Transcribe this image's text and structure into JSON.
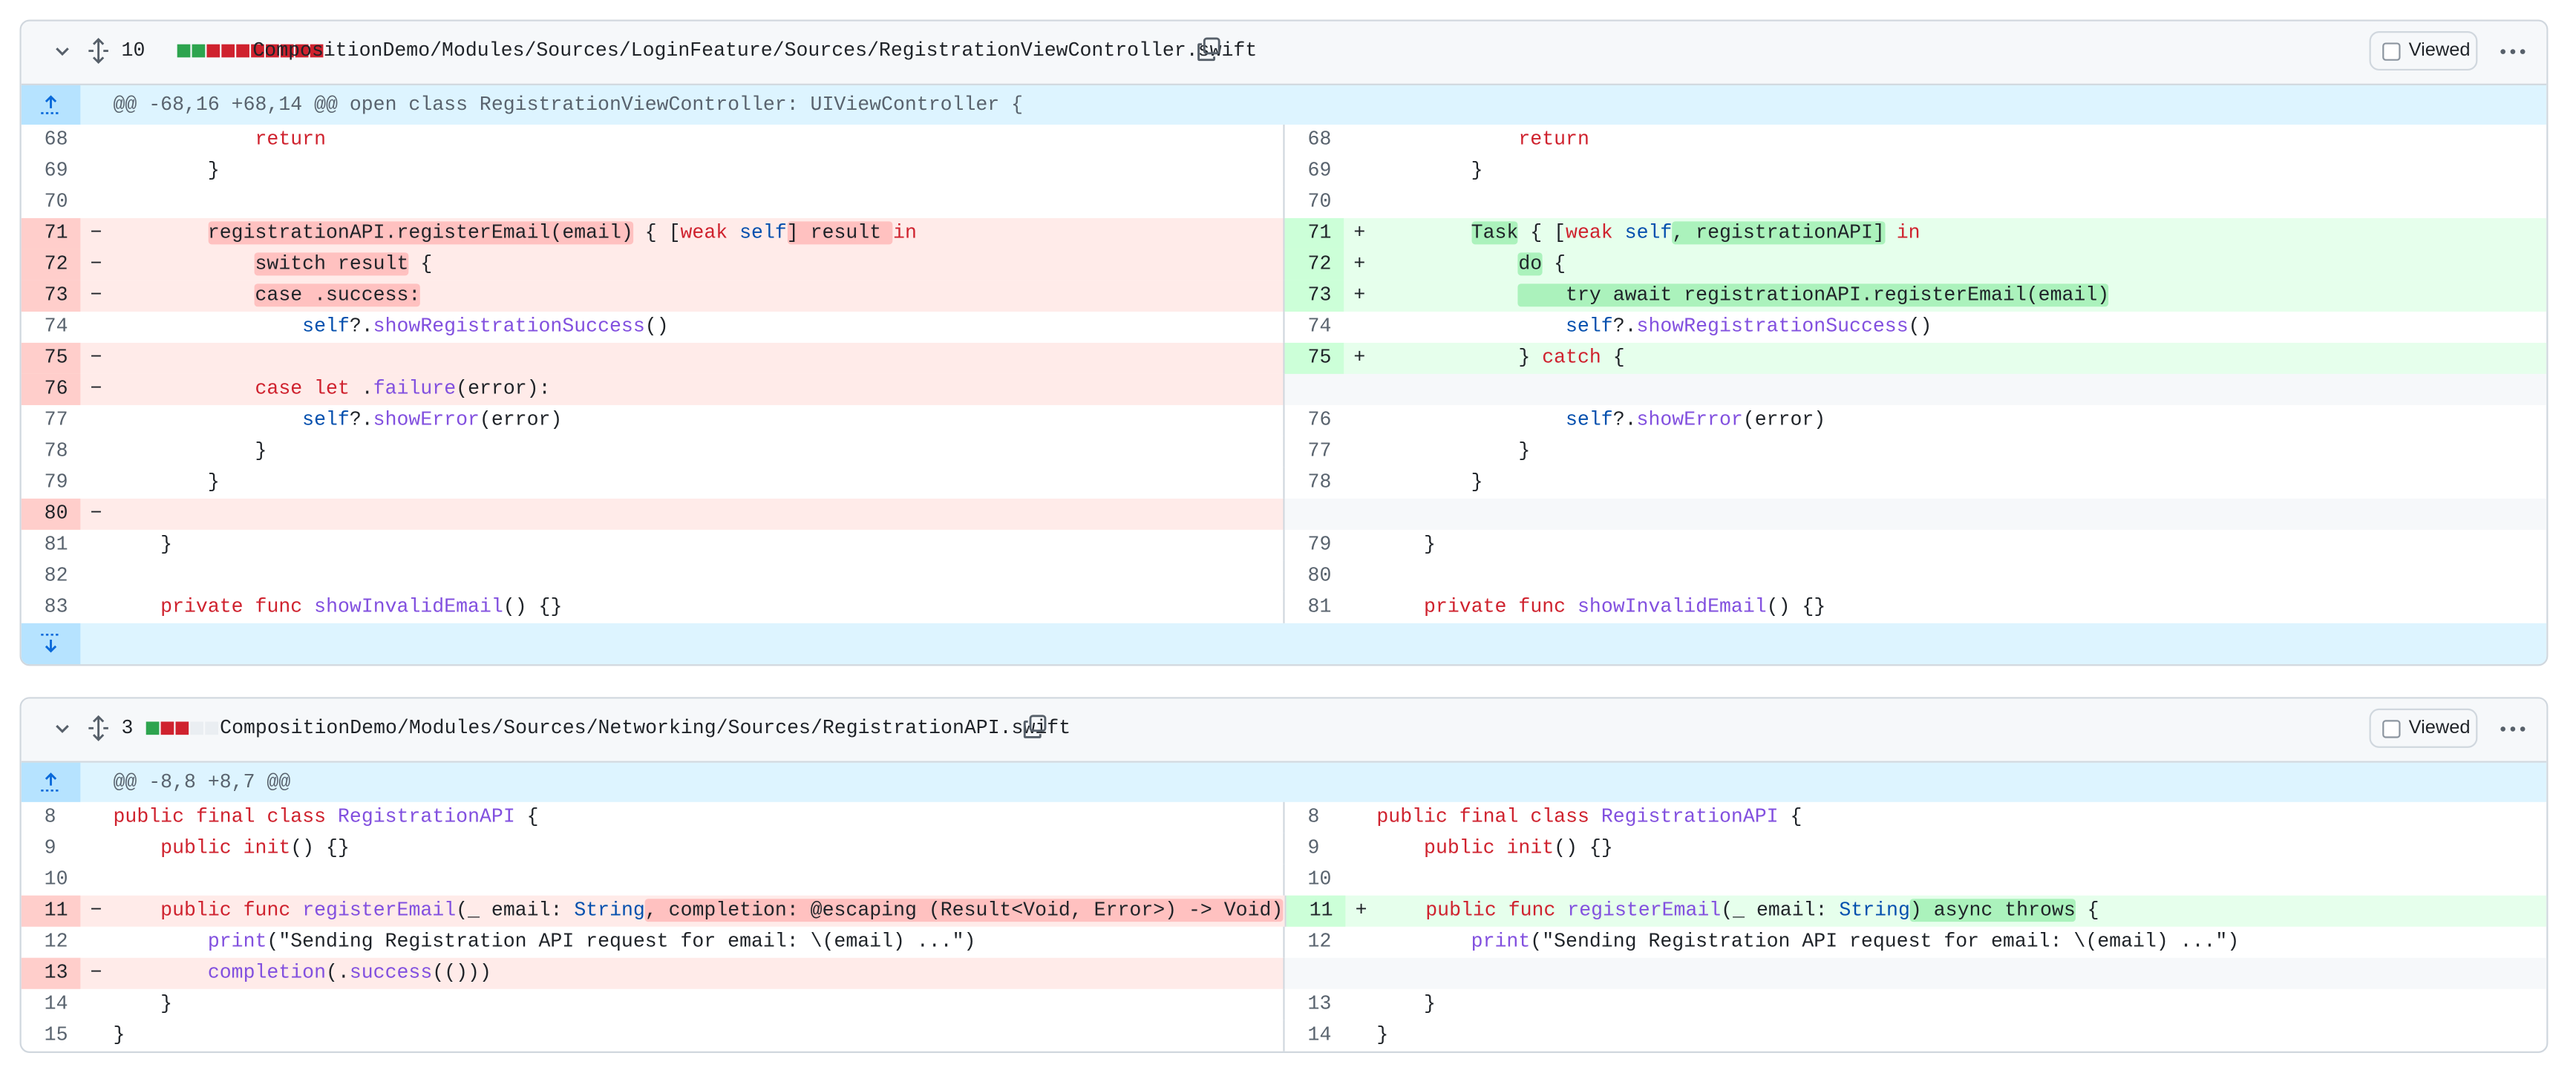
{
  "files": [
    {
      "change_count": "10",
      "blocks": [
        "add",
        "add",
        "del",
        "del",
        "del",
        "del",
        "del",
        "del",
        "del",
        "del"
      ],
      "path": "CompositionDemo/Modules/Sources/LoginFeature/Sources/RegistrationViewController.swift",
      "viewed_label": "Viewed",
      "hunk": "@@ -68,16 +68,14 @@ open class RegistrationViewController: UIViewController {",
      "rows": [
        {
          "l": {
            "n": "68",
            "t": "ctx",
            "c": [
              [
                "            ",
                ""
              ],
              [
                "return",
                "kw"
              ]
            ]
          },
          "r": {
            "n": "68",
            "t": "ctx",
            "c": [
              [
                "            ",
                ""
              ],
              [
                "return",
                "kw"
              ]
            ]
          }
        },
        {
          "l": {
            "n": "69",
            "t": "ctx",
            "c": [
              [
                "        }",
                ""
              ]
            ]
          },
          "r": {
            "n": "69",
            "t": "ctx",
            "c": [
              [
                "        }",
                ""
              ]
            ]
          }
        },
        {
          "l": {
            "n": "70",
            "t": "ctx",
            "c": []
          },
          "r": {
            "n": "70",
            "t": "ctx",
            "c": []
          }
        },
        {
          "l": {
            "n": "71",
            "t": "del",
            "c": [
              [
                "        ",
                ""
              ],
              [
                "registrationAPI.registerEmail(email)",
                "hd"
              ],
              [
                " { [",
                ""
              ],
              [
                "weak",
                "kw"
              ],
              [
                " ",
                ""
              ],
              [
                "self",
                "ty"
              ],
              [
                "] result ",
                "hd"
              ],
              [
                "in",
                "kw"
              ]
            ]
          },
          "r": {
            "n": "71",
            "t": "add",
            "c": [
              [
                "        ",
                ""
              ],
              [
                "Task",
                "ha"
              ],
              [
                " { [",
                ""
              ],
              [
                "weak",
                "kw"
              ],
              [
                " ",
                ""
              ],
              [
                "self",
                "ty"
              ],
              [
                ", registrationAPI]",
                "ha"
              ],
              [
                " ",
                ""
              ],
              [
                "in",
                "kw"
              ]
            ]
          }
        },
        {
          "l": {
            "n": "72",
            "t": "del",
            "c": [
              [
                "            ",
                ""
              ],
              [
                "switch result",
                "hd"
              ],
              [
                " {",
                ""
              ]
            ]
          },
          "r": {
            "n": "72",
            "t": "add",
            "c": [
              [
                "            ",
                ""
              ],
              [
                "do",
                "ha"
              ],
              [
                " {",
                ""
              ]
            ]
          }
        },
        {
          "l": {
            "n": "73",
            "t": "del",
            "c": [
              [
                "            ",
                ""
              ],
              [
                "case .success:",
                "hd"
              ]
            ]
          },
          "r": {
            "n": "73",
            "t": "add",
            "c": [
              [
                "            ",
                ""
              ],
              [
                "    try await registrationAPI.registerEmail(email)",
                "ha"
              ]
            ]
          }
        },
        {
          "l": {
            "n": "74",
            "t": "ctx",
            "c": [
              [
                "                ",
                ""
              ],
              [
                "self",
                "ty"
              ],
              [
                "?.",
                ""
              ],
              [
                "showRegistrationSuccess",
                "fn"
              ],
              [
                "()",
                ""
              ]
            ]
          },
          "r": {
            "n": "74",
            "t": "ctx",
            "c": [
              [
                "                ",
                ""
              ],
              [
                "self",
                "ty"
              ],
              [
                "?.",
                ""
              ],
              [
                "showRegistrationSuccess",
                "fn"
              ],
              [
                "()",
                ""
              ]
            ]
          }
        },
        {
          "l": {
            "n": "75",
            "t": "del",
            "c": []
          },
          "r": {
            "n": "75",
            "t": "add",
            "c": [
              [
                "            } ",
                ""
              ],
              [
                "catch",
                "kw"
              ],
              [
                " {",
                ""
              ]
            ]
          }
        },
        {
          "l": {
            "n": "76",
            "t": "del",
            "c": [
              [
                "            ",
                ""
              ],
              [
                "case",
                "kw"
              ],
              [
                " ",
                ""
              ],
              [
                "let",
                "kw"
              ],
              [
                " .",
                ""
              ],
              [
                "failure",
                "fn"
              ],
              [
                "(error):",
                ""
              ]
            ]
          },
          "r": {
            "n": "",
            "t": "empty",
            "c": []
          }
        },
        {
          "l": {
            "n": "77",
            "t": "ctx",
            "c": [
              [
                "                ",
                ""
              ],
              [
                "self",
                "ty"
              ],
              [
                "?.",
                ""
              ],
              [
                "showError",
                "fn"
              ],
              [
                "(error)",
                ""
              ]
            ]
          },
          "r": {
            "n": "76",
            "t": "ctx",
            "c": [
              [
                "                ",
                ""
              ],
              [
                "self",
                "ty"
              ],
              [
                "?.",
                ""
              ],
              [
                "showError",
                "fn"
              ],
              [
                "(error)",
                ""
              ]
            ]
          }
        },
        {
          "l": {
            "n": "78",
            "t": "ctx",
            "c": [
              [
                "            }",
                ""
              ]
            ]
          },
          "r": {
            "n": "77",
            "t": "ctx",
            "c": [
              [
                "            }",
                ""
              ]
            ]
          }
        },
        {
          "l": {
            "n": "79",
            "t": "ctx",
            "c": [
              [
                "        }",
                ""
              ]
            ]
          },
          "r": {
            "n": "78",
            "t": "ctx",
            "c": [
              [
                "        }",
                ""
              ]
            ]
          }
        },
        {
          "l": {
            "n": "80",
            "t": "del",
            "c": []
          },
          "r": {
            "n": "",
            "t": "empty",
            "c": []
          }
        },
        {
          "l": {
            "n": "81",
            "t": "ctx",
            "c": [
              [
                "    }",
                ""
              ]
            ]
          },
          "r": {
            "n": "79",
            "t": "ctx",
            "c": [
              [
                "    }",
                ""
              ]
            ]
          }
        },
        {
          "l": {
            "n": "82",
            "t": "ctx",
            "c": []
          },
          "r": {
            "n": "80",
            "t": "ctx",
            "c": []
          }
        },
        {
          "l": {
            "n": "83",
            "t": "ctx",
            "c": [
              [
                "    ",
                ""
              ],
              [
                "private",
                "kw"
              ],
              [
                " ",
                ""
              ],
              [
                "func",
                "kw"
              ],
              [
                " ",
                ""
              ],
              [
                "showInvalidEmail",
                "fn"
              ],
              [
                "() {}",
                ""
              ]
            ]
          },
          "r": {
            "n": "81",
            "t": "ctx",
            "c": [
              [
                "    ",
                ""
              ],
              [
                "private",
                "kw"
              ],
              [
                " ",
                ""
              ],
              [
                "func",
                "kw"
              ],
              [
                " ",
                ""
              ],
              [
                "showInvalidEmail",
                "fn"
              ],
              [
                "() {}",
                ""
              ]
            ]
          }
        }
      ]
    },
    {
      "change_count": "3",
      "blocks": [
        "add",
        "del",
        "del",
        "neutral",
        "neutral"
      ],
      "path": "CompositionDemo/Modules/Sources/Networking/Sources/RegistrationAPI.swift",
      "viewed_label": "Viewed",
      "hunk": "@@ -8,8 +8,7 @@",
      "rows": [
        {
          "l": {
            "n": "8",
            "t": "ctx",
            "c": [
              [
                "public",
                "kw"
              ],
              [
                " ",
                ""
              ],
              [
                "final",
                "kw"
              ],
              [
                " ",
                ""
              ],
              [
                "class",
                "kw"
              ],
              [
                " ",
                ""
              ],
              [
                "RegistrationAPI",
                "fn"
              ],
              [
                " {",
                ""
              ]
            ]
          },
          "r": {
            "n": "8",
            "t": "ctx",
            "c": [
              [
                "public",
                "kw"
              ],
              [
                " ",
                ""
              ],
              [
                "final",
                "kw"
              ],
              [
                " ",
                ""
              ],
              [
                "class",
                "kw"
              ],
              [
                " ",
                ""
              ],
              [
                "RegistrationAPI",
                "fn"
              ],
              [
                " {",
                ""
              ]
            ]
          }
        },
        {
          "l": {
            "n": "9",
            "t": "ctx",
            "c": [
              [
                "    ",
                ""
              ],
              [
                "public",
                "kw"
              ],
              [
                " ",
                ""
              ],
              [
                "init",
                "kw"
              ],
              [
                "() {}",
                ""
              ]
            ]
          },
          "r": {
            "n": "9",
            "t": "ctx",
            "c": [
              [
                "    ",
                ""
              ],
              [
                "public",
                "kw"
              ],
              [
                " ",
                ""
              ],
              [
                "init",
                "kw"
              ],
              [
                "() {}",
                ""
              ]
            ]
          }
        },
        {
          "l": {
            "n": "10",
            "t": "ctx",
            "c": []
          },
          "r": {
            "n": "10",
            "t": "ctx",
            "c": []
          }
        },
        {
          "l": {
            "n": "11",
            "t": "del",
            "c": [
              [
                "    ",
                ""
              ],
              [
                "public",
                "kw"
              ],
              [
                " ",
                ""
              ],
              [
                "func",
                "kw"
              ],
              [
                " ",
                ""
              ],
              [
                "registerEmail",
                "fn"
              ],
              [
                "(_ email: ",
                ""
              ],
              [
                "String",
                "ty"
              ],
              [
                ", completion: @escaping (Result<Void, Error>) -> Void)",
                "hd"
              ],
              [
                " {",
                ""
              ]
            ]
          },
          "r": {
            "n": "11",
            "t": "add",
            "c": [
              [
                "    ",
                ""
              ],
              [
                "public",
                "kw"
              ],
              [
                " ",
                ""
              ],
              [
                "func",
                "kw"
              ],
              [
                " ",
                ""
              ],
              [
                "registerEmail",
                "fn"
              ],
              [
                "(_ email: ",
                ""
              ],
              [
                "String",
                "ty"
              ],
              [
                ") async throws",
                "ha"
              ],
              [
                " {",
                ""
              ]
            ]
          }
        },
        {
          "l": {
            "n": "12",
            "t": "ctx",
            "c": [
              [
                "        ",
                ""
              ],
              [
                "print",
                "fn"
              ],
              [
                "(\"Sending Registration API request for email: \\(email) ...\")",
                ""
              ]
            ]
          },
          "r": {
            "n": "12",
            "t": "ctx",
            "c": [
              [
                "        ",
                ""
              ],
              [
                "print",
                "fn"
              ],
              [
                "(\"Sending Registration API request for email: \\(email) ...\")",
                ""
              ]
            ]
          }
        },
        {
          "l": {
            "n": "13",
            "t": "del",
            "c": [
              [
                "        ",
                ""
              ],
              [
                "completion",
                "fn"
              ],
              [
                "(.",
                ""
              ],
              [
                "success",
                "fn"
              ],
              [
                "(()))",
                ""
              ]
            ]
          },
          "r": {
            "n": "",
            "t": "empty",
            "c": []
          }
        },
        {
          "l": {
            "n": "14",
            "t": "ctx",
            "c": [
              [
                "    }",
                ""
              ]
            ]
          },
          "r": {
            "n": "13",
            "t": "ctx",
            "c": [
              [
                "    }",
                ""
              ]
            ]
          }
        },
        {
          "l": {
            "n": "15",
            "t": "ctx",
            "c": [
              [
                "}",
                ""
              ]
            ]
          },
          "r": {
            "n": "14",
            "t": "ctx",
            "c": [
              [
                "}",
                ""
              ]
            ]
          }
        }
      ]
    }
  ],
  "colors": {
    "add_block": "#2da44e",
    "del_block": "#cf222e",
    "neutral_block": "#eaeef2"
  }
}
